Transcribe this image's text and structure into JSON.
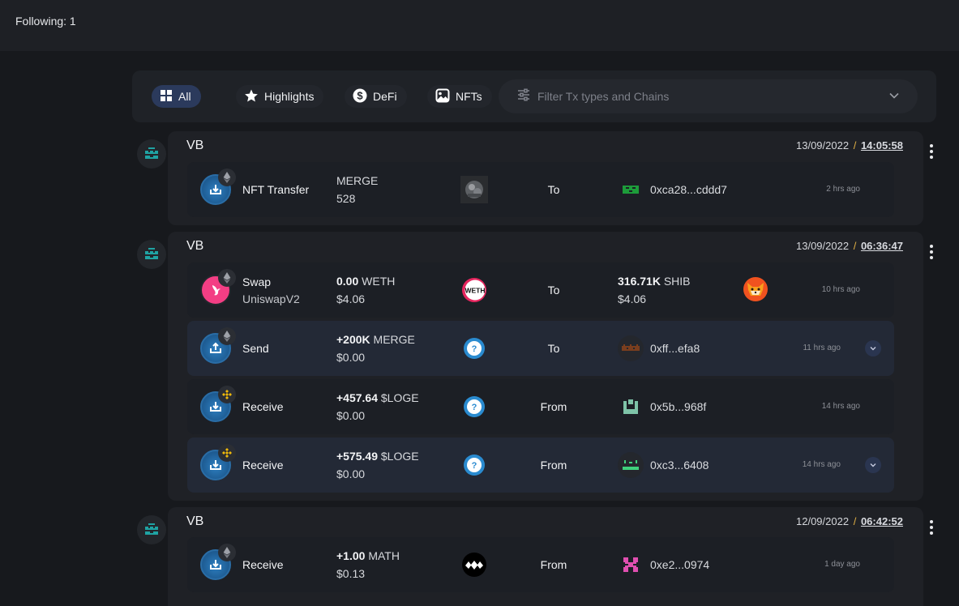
{
  "header": {
    "following": "Following: 1"
  },
  "filters": {
    "tabs": [
      {
        "label": "All",
        "icon": "grid-icon",
        "active": true
      },
      {
        "label": "Highlights",
        "icon": "star-icon"
      },
      {
        "label": "DeFi",
        "icon": "dollar-icon"
      },
      {
        "label": "NFTs",
        "icon": "image-icon"
      }
    ],
    "search_placeholder": "Filter Tx types and Chains"
  },
  "groups": [
    {
      "name": "VB",
      "date": "13/09/2022",
      "sep": "/",
      "time": "14:05:58",
      "rows": [
        {
          "action": "NFT Transfer",
          "amount_label": "MERGE",
          "amount_sub": "528",
          "direction": "To",
          "address": "0xca28...cddd7",
          "ago": "2 hrs ago"
        }
      ]
    },
    {
      "name": "VB",
      "date": "13/09/2022",
      "sep": "/",
      "time": "06:36:47",
      "rows": [
        {
          "action": "Swap",
          "action_sub": "UniswapV2",
          "amount_value": "0.00",
          "amount_token": "WETH",
          "amount_usd": "$4.06",
          "direction": "To",
          "out_value": "316.71K",
          "out_token": "SHIB",
          "out_usd": "$4.06",
          "ago": "10 hrs ago",
          "token_label": "WETH"
        },
        {
          "action": "Send",
          "amount_value": "+200K",
          "amount_token": "MERGE",
          "amount_usd": "$0.00",
          "direction": "To",
          "address": "0xff...efa8",
          "ago": "11 hrs ago"
        },
        {
          "action": "Receive",
          "amount_value": "+457.64",
          "amount_token": "$LOGE",
          "amount_usd": "$0.00",
          "direction": "From",
          "address": "0x5b...968f",
          "ago": "14 hrs ago"
        },
        {
          "action": "Receive",
          "amount_value": "+575.49",
          "amount_token": "$LOGE",
          "amount_usd": "$0.00",
          "direction": "From",
          "address": "0xc3...6408",
          "ago": "14 hrs ago"
        }
      ]
    },
    {
      "name": "VB",
      "date": "12/09/2022",
      "sep": "/",
      "time": "06:42:52",
      "rows": [
        {
          "action": "Receive",
          "amount_value": "+1.00",
          "amount_token": "MATH",
          "amount_usd": "$0.13",
          "direction": "From",
          "address": "0xe2...0974",
          "ago": "1 day ago"
        }
      ]
    }
  ],
  "colors": {
    "accent": "#e0b045",
    "active_tab": "#2b3a5c",
    "avatar_teal": "#1fa3a3"
  }
}
